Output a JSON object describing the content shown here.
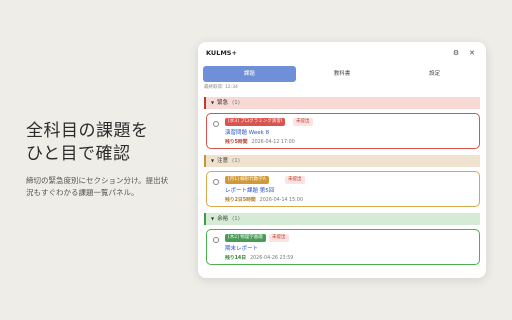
{
  "promo": {
    "title_line1": "全科目の課題を",
    "title_line2": "ひと目で確認",
    "sub_line1": "締切の緊急度別にセクション分け。提出状",
    "sub_line2": "況もすぐわかる課題一覧パネル。"
  },
  "panel": {
    "app_title": "KULMS+",
    "settings_icon": "gear-icon",
    "close_icon": "close-icon",
    "tabs": [
      {
        "label": "課題",
        "active": true
      },
      {
        "label": "教科書",
        "active": false
      },
      {
        "label": "設定",
        "active": false
      }
    ],
    "last_fetched": "最終取得: 12:34"
  },
  "sections": [
    {
      "name": "緊急",
      "count": "(1)",
      "color": "#c0392b",
      "card": {
        "course": "[水3] プログラミング演習I",
        "status": "未提出",
        "title": "演習問題 Week 8",
        "remaining": "残り5時間",
        "due": "2026-04-12 17:00"
      }
    },
    {
      "name": "注意",
      "count": "(1)",
      "color": "#c8962e",
      "card": {
        "course": "[月1] 線形代数学A",
        "status": "未提出",
        "title": "レポート課題 第5回",
        "remaining": "残り2日5時間",
        "due": "2026-04-14 15:00"
      }
    },
    {
      "name": "余裕",
      "count": "(1)",
      "color": "#3f9a4e",
      "card": {
        "course": "[木2] 物理学基礎",
        "status": "未提出",
        "title": "期末レポート",
        "remaining": "残り14日",
        "due": "2026-04-26 23:59"
      }
    }
  ]
}
